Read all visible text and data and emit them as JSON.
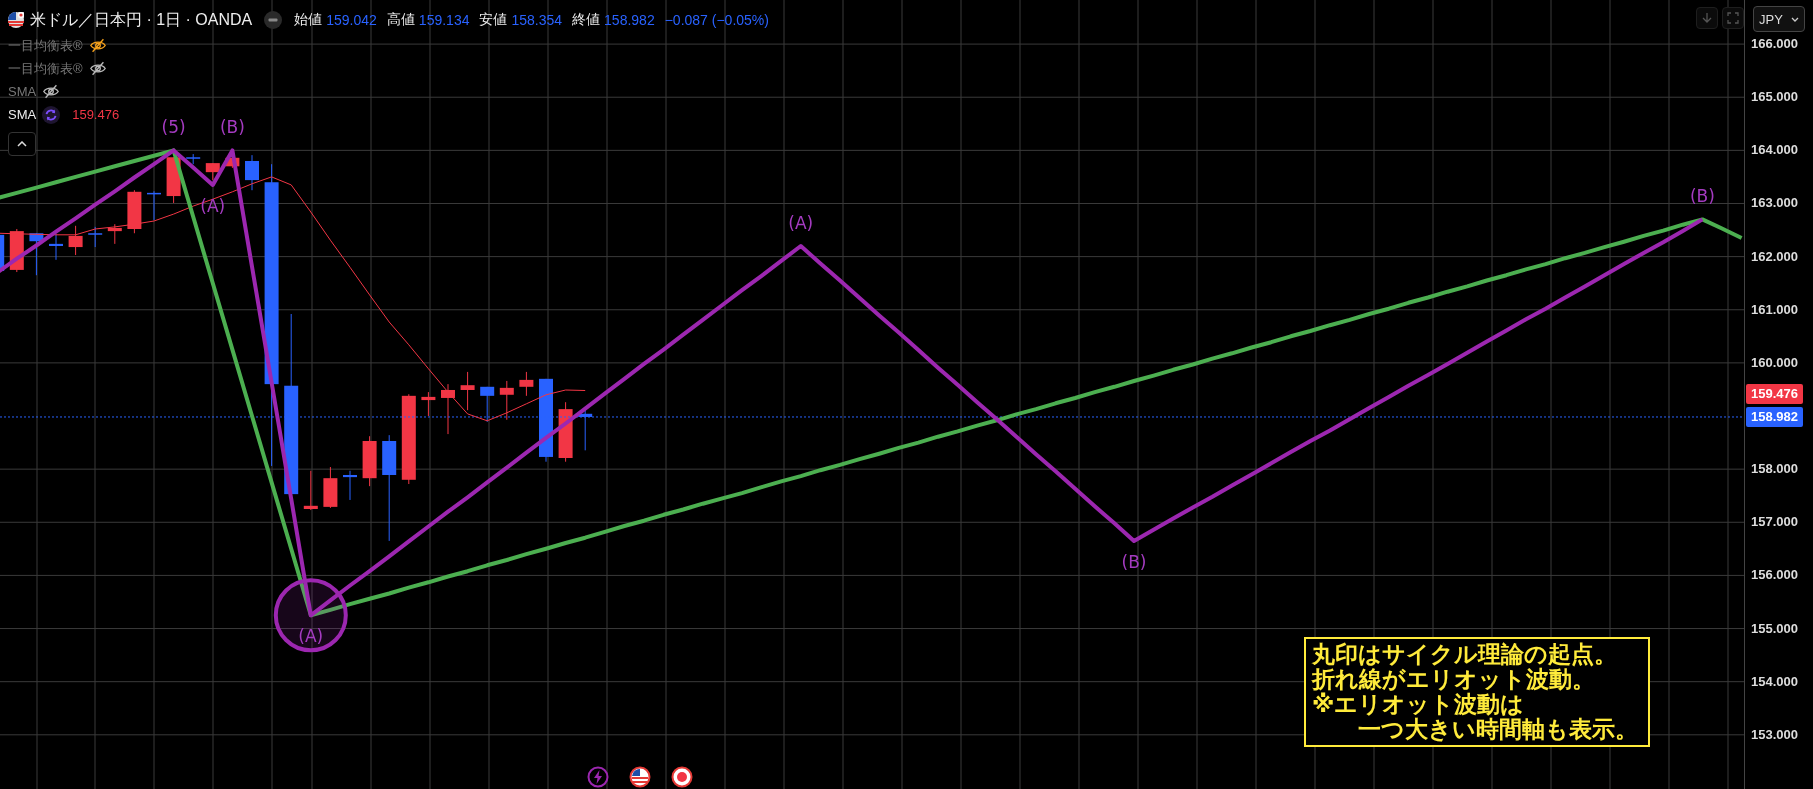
{
  "header": {
    "symbol": "米ドル／日本円 · 1日 · OANDA",
    "quote": [
      {
        "label": "始値",
        "value": "159.042"
      },
      {
        "label": "高値",
        "value": "159.134"
      },
      {
        "label": "安値",
        "value": "158.354"
      },
      {
        "label": "終値",
        "value": "158.982"
      }
    ],
    "change": "−0.087 (−0.05%)"
  },
  "indicators": [
    {
      "name": "一目均衡表®",
      "visible": false,
      "selected": true
    },
    {
      "name": "一目均衡表®",
      "visible": false,
      "selected": false
    },
    {
      "name": "SMA",
      "visible": false,
      "selected": false
    },
    {
      "name": "SMA",
      "visible": true,
      "selected": false,
      "value": "159.476"
    }
  ],
  "currency": "JPY",
  "chart": {
    "chart_data": {
      "type": "candlestick",
      "grid": true,
      "ylim": [
        151.98,
        166.83
      ],
      "ohlc": [
        [
          162.41,
          162.44,
          161.71,
          161.73
        ],
        [
          161.75,
          162.52,
          161.71,
          162.48
        ],
        [
          162.44,
          162.44,
          161.65,
          162.29
        ],
        [
          162.24,
          162.43,
          161.94,
          162.2
        ],
        [
          162.18,
          162.58,
          162.03,
          162.39
        ],
        [
          162.44,
          162.56,
          162.18,
          162.43
        ],
        [
          162.48,
          162.61,
          162.24,
          162.54
        ],
        [
          162.52,
          163.25,
          162.44,
          163.22
        ],
        [
          163.2,
          163.23,
          162.69,
          163.18
        ],
        [
          163.14,
          163.87,
          163.01,
          163.87
        ],
        [
          163.87,
          163.93,
          163.74,
          163.86
        ],
        [
          163.59,
          163.76,
          163.44,
          163.76
        ],
        [
          163.7,
          163.89,
          163.67,
          163.86
        ],
        [
          163.8,
          163.91,
          163.25,
          163.44
        ],
        [
          163.4,
          163.74,
          158.06,
          159.6
        ],
        [
          159.57,
          160.92,
          157.53,
          157.53
        ],
        [
          157.25,
          157.97,
          157.23,
          157.31
        ],
        [
          157.29,
          158.04,
          157.27,
          157.83
        ],
        [
          157.89,
          157.97,
          157.42,
          157.85
        ],
        [
          157.83,
          158.62,
          157.68,
          158.53
        ],
        [
          158.53,
          158.64,
          156.65,
          157.89
        ],
        [
          157.8,
          159.41,
          157.72,
          159.38
        ],
        [
          159.3,
          159.45,
          159.0,
          159.36
        ],
        [
          159.34,
          159.6,
          158.66,
          159.49
        ],
        [
          159.49,
          159.83,
          159.11,
          159.58
        ],
        [
          159.55,
          159.55,
          158.89,
          159.38
        ],
        [
          159.4,
          159.66,
          158.93,
          159.53
        ],
        [
          159.55,
          159.83,
          159.38,
          159.68
        ],
        [
          159.7,
          159.7,
          158.14,
          158.23
        ],
        [
          158.21,
          159.26,
          158.14,
          159.13
        ],
        [
          159.042,
          159.134,
          158.354,
          158.982
        ],
        null,
        null,
        null,
        null,
        null,
        null,
        null,
        null,
        null,
        null,
        null,
        null,
        null,
        null,
        null,
        null,
        null,
        null,
        null,
        null,
        null,
        null,
        null,
        null,
        null,
        null,
        null,
        null,
        null,
        null,
        null,
        null,
        null,
        null,
        null,
        null,
        null,
        null,
        null,
        null,
        null,
        null,
        null,
        null,
        null,
        null,
        null,
        null,
        null,
        null,
        null,
        null,
        null,
        null,
        null,
        null,
        null,
        null,
        null
      ],
      "categories": [
        null,
        null,
        null,
        null,
        null,
        null,
        null,
        null,
        null,
        null,
        null,
        null,
        null,
        null,
        null,
        null,
        null,
        null,
        null,
        null,
        null,
        null,
        null,
        null,
        null,
        null,
        null,
        null,
        null,
        null,
        null,
        null,
        null,
        null,
        null,
        null,
        null,
        null,
        null,
        null,
        null,
        null,
        null,
        null,
        null,
        null,
        null,
        null,
        null,
        null,
        null,
        null,
        null,
        null,
        null,
        null,
        null,
        null,
        null,
        null,
        null,
        null,
        null,
        null,
        null,
        null,
        null,
        null,
        null,
        null,
        null,
        null,
        null,
        null,
        null,
        null,
        null,
        null,
        null,
        null,
        null,
        null,
        null,
        null,
        null,
        null,
        null,
        null,
        null,
        null
      ],
      "yticks": [
        {
          "value": 166,
          "label": "166.000"
        },
        {
          "value": 165,
          "label": "165.000"
        },
        {
          "value": 164,
          "label": "164.000"
        },
        {
          "value": 163,
          "label": "163.000"
        },
        {
          "value": 162,
          "label": "162.000"
        },
        {
          "value": 161,
          "label": "161.000"
        },
        {
          "value": 160,
          "label": "160.000"
        },
        {
          "value": 158,
          "label": "158.000"
        },
        {
          "value": 157,
          "label": "157.000"
        },
        {
          "value": 156,
          "label": "156.000"
        },
        {
          "value": 155,
          "label": "155.000"
        },
        {
          "value": 154,
          "label": "154.000"
        },
        {
          "value": 153,
          "label": "153.000"
        }
      ],
      "series": [
        {
          "type": "line",
          "color": "#f23645",
          "values": [
            162.44,
            162.43,
            162.42,
            162.41,
            162.41,
            162.52,
            162.56,
            162.61,
            162.67,
            162.8,
            162.95,
            163.08,
            163.22,
            163.37,
            163.5,
            163.35,
            162.84,
            162.31,
            161.8,
            161.28,
            160.77,
            160.34,
            159.89,
            159.45,
            159.04,
            158.91,
            159.06,
            159.23,
            159.4,
            159.49,
            159.48,
            null,
            null,
            null,
            null,
            null,
            null,
            null,
            null,
            null,
            null,
            null,
            null,
            null,
            null,
            null,
            null,
            null,
            null,
            null,
            null,
            null,
            null,
            null,
            null,
            null,
            null,
            null,
            null,
            null,
            null,
            null,
            null,
            null,
            null,
            null,
            null,
            null,
            null,
            null,
            null,
            null,
            null,
            null,
            null,
            null,
            null,
            null,
            null,
            null,
            null,
            null,
            null,
            null,
            null,
            null,
            null,
            null,
            null,
            null
          ]
        },
        {
          "type": "line",
          "color": "#4caf50",
          "values": [
            163.1,
            163.2,
            163.3,
            163.4,
            163.5,
            163.6,
            163.7,
            163.8,
            163.9,
            164.0,
            162.75,
            161.5,
            160.25,
            159.0,
            157.75,
            156.5,
            155.25,
            155.35,
            155.46,
            155.56,
            155.66,
            155.77,
            155.87,
            155.98,
            156.08,
            156.19,
            156.29,
            156.4,
            156.5,
            156.61,
            156.71,
            156.82,
            156.93,
            157.03,
            157.14,
            157.24,
            157.35,
            157.45,
            157.55,
            157.66,
            157.77,
            157.87,
            157.98,
            158.08,
            158.19,
            158.29,
            158.4,
            158.5,
            158.61,
            158.71,
            158.82,
            158.92,
            159.03,
            159.13,
            159.24,
            159.34,
            159.45,
            159.55,
            159.66,
            159.76,
            159.87,
            159.97,
            160.08,
            160.18,
            160.29,
            160.39,
            160.5,
            160.6,
            160.71,
            160.81,
            160.92,
            161.02,
            161.13,
            161.23,
            161.34,
            161.44,
            161.55,
            161.65,
            161.76,
            161.86,
            161.97,
            162.07,
            162.18,
            162.28,
            162.39,
            162.49,
            162.6,
            162.7,
            162.53,
            162.35
          ]
        },
        {
          "type": "line",
          "color": "#9c27b0",
          "values": [
            161.7,
            161.96,
            162.21,
            162.47,
            162.72,
            162.98,
            163.23,
            163.49,
            163.74,
            164.0,
            163.68,
            163.35,
            164.0,
            161.81,
            159.63,
            157.44,
            155.25,
            155.53,
            155.81,
            156.08,
            156.36,
            156.64,
            156.92,
            157.2,
            157.47,
            157.75,
            158.03,
            158.31,
            158.59,
            158.86,
            159.14,
            159.42,
            159.7,
            159.98,
            160.25,
            160.53,
            160.81,
            161.09,
            161.37,
            161.64,
            161.92,
            162.2,
            161.87,
            161.55,
            161.22,
            160.89,
            160.57,
            160.24,
            159.91,
            159.59,
            159.26,
            158.94,
            158.61,
            158.28,
            157.96,
            157.63,
            157.3,
            156.98,
            156.65,
            156.86,
            157.07,
            157.28,
            157.48,
            157.69,
            157.9,
            158.11,
            158.32,
            158.53,
            158.73,
            158.94,
            159.15,
            159.36,
            159.57,
            159.77,
            159.98,
            160.19,
            160.4,
            160.61,
            160.82,
            161.02,
            161.23,
            161.44,
            161.65,
            161.86,
            162.07,
            162.27,
            162.48,
            162.7,
            null,
            null
          ]
        }
      ],
      "annotations": [
        {
          "text": "(5)"
        },
        {
          "text": "(A)"
        },
        {
          "text": "(B)"
        },
        {
          "text": "(A)"
        },
        {
          "text": "(A)"
        },
        {
          "text": "(B)"
        },
        {
          "text": "(B)"
        }
      ],
      "ref_lines": [
        {
          "axis": "y",
          "value": 158.982,
          "label": "158.982",
          "color": "#2962ff"
        }
      ]
    },
    "sma_label": {
      "text": "159.476",
      "color": "#f23645"
    }
  },
  "note": [
    "丸印はサイクル理論の起点。",
    "折れ線がエリオット波動。",
    "※エリオット波動は",
    "　　一つ大きい時間軸も表示。"
  ]
}
